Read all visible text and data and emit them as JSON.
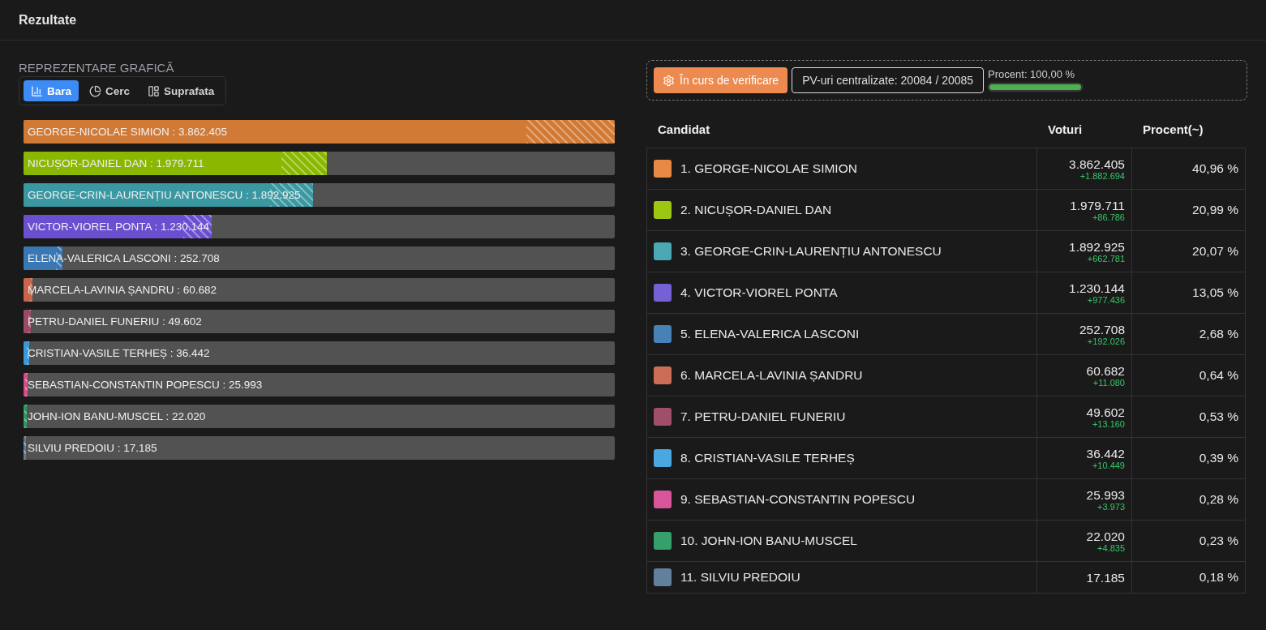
{
  "header": {
    "title": "Rezultate"
  },
  "chart_panel": {
    "title": "REPREZENTARE GRAFICĂ",
    "tabs": [
      {
        "label": "Bara",
        "kind": "bar",
        "selected": true
      },
      {
        "label": "Cerc",
        "kind": "pie",
        "selected": false
      },
      {
        "label": "Suprafata",
        "kind": "area",
        "selected": false
      }
    ],
    "bars": [
      {
        "label": "GEORGE-NICOLAE SIMION : 3.862.405",
        "color": "#d17a36",
        "level": 1.0
      },
      {
        "label": "NICUȘOR-DANIEL DAN : 1.979.711",
        "color": "#8ab800",
        "level": 0.5126
      },
      {
        "label": "GEORGE-CRIN-LAURENȚIU ANTONESCU : 1.892.925",
        "color": "#3a98a2",
        "level": 0.4901
      },
      {
        "label": "VICTOR-VIOREL PONTA : 1.230.144",
        "color": "#6a50d0",
        "level": 0.3185
      },
      {
        "label": "ELENA-VALERICA LASCONI : 252.708",
        "color": "#3a78b4",
        "level": 0.0654
      },
      {
        "label": "MARCELA-LAVINIA ȘANDRU : 60.682",
        "color": "#c8654a",
        "level": 0.0157
      },
      {
        "label": "PETRU-DANIEL FUNERIU : 49.602",
        "color": "#9a4a66",
        "level": 0.0128
      },
      {
        "label": "CRISTIAN-VASILE TERHEȘ : 36.442",
        "color": "#3a9ad8",
        "level": 0.0094
      },
      {
        "label": "SEBASTIAN-CONSTANTIN POPESCU : 25.993",
        "color": "#d84a8a",
        "level": 0.0067
      },
      {
        "label": "JOHN-ION BANU-MUSCEL : 22.020",
        "color": "#2a9a60",
        "level": 0.0057
      },
      {
        "label": "SILVIU PREDOIU : 17.185",
        "color": "#5a7a9a",
        "level": 0.0044
      }
    ]
  },
  "status": {
    "badge": "În curs de verificare",
    "pv": "PV-uri centralizate: 20084 / 20085",
    "progress_label": "Procent: 100,00 %",
    "level": 1.0
  },
  "table": {
    "columns": [
      "Candidat",
      "Voturi",
      "Procent(~)"
    ],
    "rows": [
      {
        "candidate": "1. GEORGE-NICOLAE SIMION",
        "color": "#e88a45",
        "votes": "3.862.405",
        "delta": "+1.882.694",
        "percent": "40,96 %"
      },
      {
        "candidate": "2. NICUȘOR-DANIEL DAN",
        "color": "#9cc813",
        "votes": "1.979.711",
        "delta": "+86.786",
        "percent": "20,99 %"
      },
      {
        "candidate": "3. GEORGE-CRIN-LAURENȚIU ANTONESCU",
        "color": "#4aa8b3",
        "votes": "1.892.925",
        "delta": "+662.781",
        "percent": "20,07 %"
      },
      {
        "candidate": "4. VICTOR-VIOREL PONTA",
        "color": "#7560d6",
        "votes": "1.230.144",
        "delta": "+977.436",
        "percent": "13,05 %"
      },
      {
        "candidate": "5. ELENA-VALERICA LASCONI",
        "color": "#4682b8",
        "votes": "252.708",
        "delta": "+192.026",
        "percent": "2,68 %"
      },
      {
        "candidate": "6. MARCELA-LAVINIA ȘANDRU",
        "color": "#cc6d55",
        "votes": "60.682",
        "delta": "+11.080",
        "percent": "0,64 %"
      },
      {
        "candidate": "7. PETRU-DANIEL FUNERIU",
        "color": "#a04f6a",
        "votes": "49.602",
        "delta": "+13.160",
        "percent": "0,53 %"
      },
      {
        "candidate": "8. CRISTIAN-VASILE TERHEȘ",
        "color": "#4aa8e0",
        "votes": "36.442",
        "delta": "+10.449",
        "percent": "0,39 %"
      },
      {
        "candidate": "9. SEBASTIAN-CONSTANTIN POPESCU",
        "color": "#d8559a",
        "votes": "25.993",
        "delta": "+3.973",
        "percent": "0,28 %"
      },
      {
        "candidate": "10. JOHN-ION BANU-MUSCEL",
        "color": "#35a06a",
        "votes": "22.020",
        "delta": "+4.835",
        "percent": "0,23 %"
      },
      {
        "candidate": "11. SILVIU PREDOIU",
        "color": "#62809c",
        "votes": "17.185",
        "percent": "0,18 %"
      }
    ]
  }
}
